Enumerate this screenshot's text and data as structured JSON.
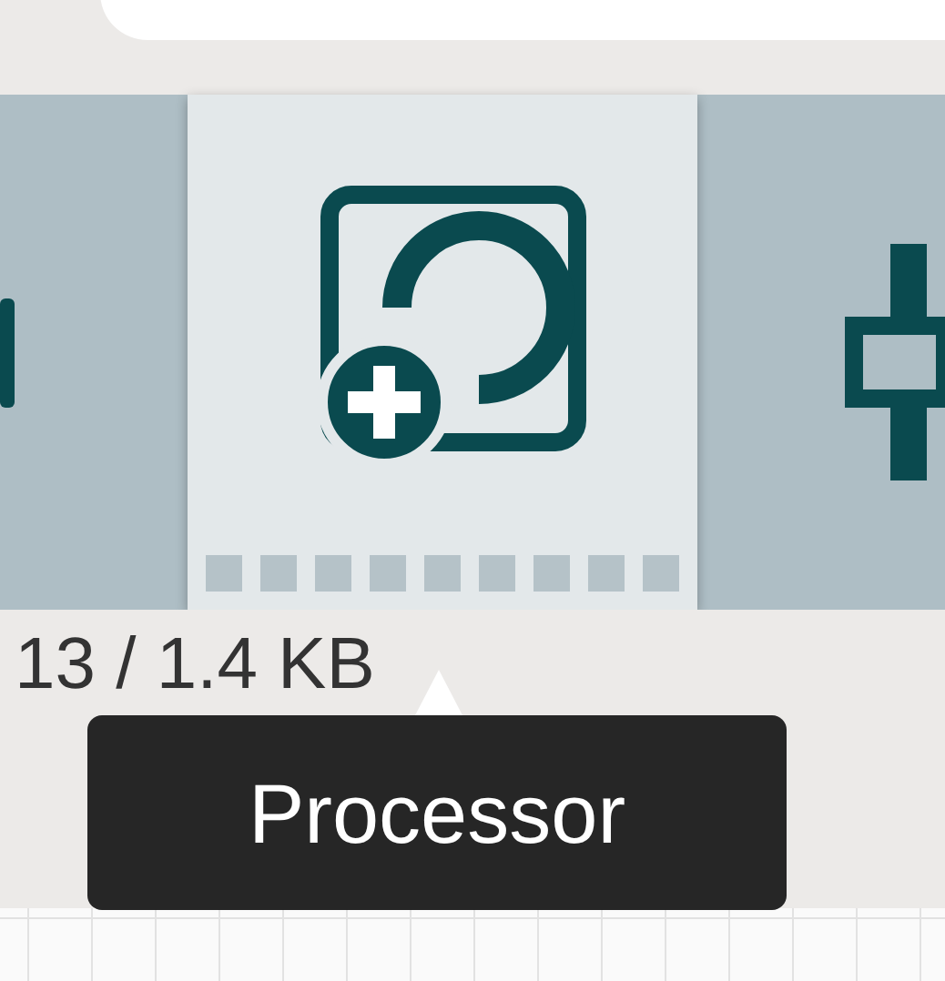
{
  "toolbar": {
    "items": [
      {
        "kind": "edge",
        "selected": false
      },
      {
        "kind": "processor",
        "selected": true
      },
      {
        "kind": "port",
        "selected": false
      }
    ]
  },
  "stats": "13 / 1.4 KB",
  "tooltip": "Processor"
}
